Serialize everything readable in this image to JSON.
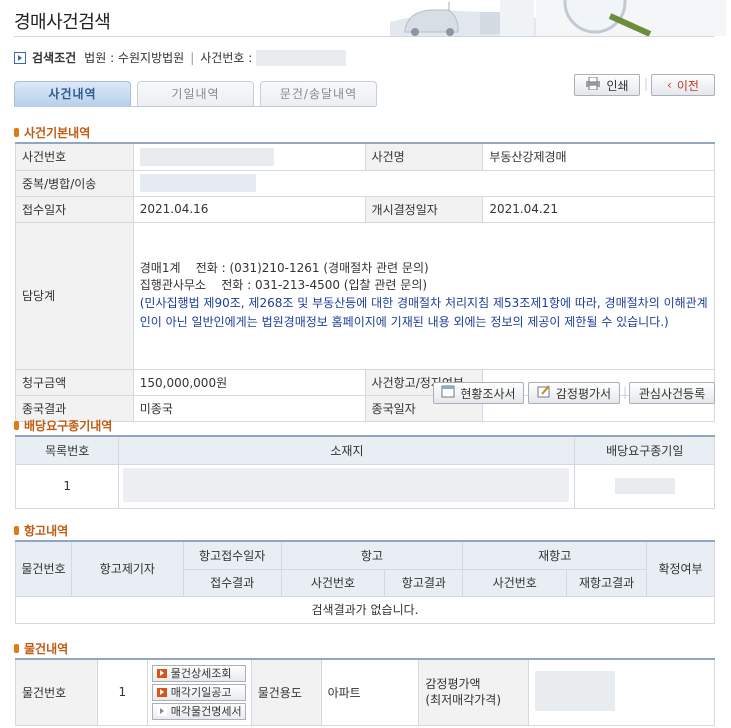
{
  "page": {
    "title": "경매사건검색"
  },
  "search_condition": {
    "label": "검색조건",
    "court_label": "법원 :",
    "court_value": "수원지방법원",
    "case_label": "사건번호 :"
  },
  "tabs": [
    {
      "label": "사건내역",
      "active": true
    },
    {
      "label": "기일내역",
      "active": false
    },
    {
      "label": "문건/송달내역",
      "active": false
    }
  ],
  "actions": {
    "print": "인쇄",
    "back": "이전"
  },
  "case_basic": {
    "title": "사건기본내역",
    "case_no_label": "사건번호",
    "case_name_label": "사건명",
    "case_name_value": "부동산강제경매",
    "merge_label": "중복/병합/이송",
    "received_label": "접수일자",
    "received_value": "2021.04.16",
    "start_label": "개시결정일자",
    "start_value": "2021.04.21",
    "officer_label": "담당계",
    "officer_line1": "경매1계    전화 : (031)210-1261 (경매절차 관련 문의)",
    "officer_line2": "집행관사무소    전화 : 031-213-4500 (입찰 관련 문의)",
    "officer_notice": "(민사집행법 제90조, 제268조 및 부동산등에 대한 경매절차 처리지침 제53조제1항에 따라, 경매절차의 이해관계인이 아닌 일반인에게는 법원경매정보 홈페이지에 기재된 내용 외에는 정보의 제공이 제한될 수 있습니다.)",
    "claim_label": "청구금액",
    "claim_value": "150,000,000원",
    "appeal_label": "사건항고/정지여부",
    "final_label": "종국결과",
    "final_value": "미종국",
    "final_date_label": "종국일자"
  },
  "case_buttons": {
    "survey": "현황조사서",
    "appraisal": "감정평가서",
    "watch": "관심사건등록"
  },
  "dividend": {
    "title": "배당요구종기내역",
    "headers": [
      "목록번호",
      "소재지",
      "배당요구종기일"
    ],
    "row_no": "1"
  },
  "appeal": {
    "title": "항고내역",
    "h_item": "물건번호",
    "h_appellant": "항고제기자",
    "h_date": "항고접수일자",
    "h_result": "접수결과",
    "h_appeal": "항고",
    "h_reappeal": "재항고",
    "h_confirm": "확정여부",
    "h_case": "사건번호",
    "h_appeal_result": "항고결과",
    "h_recase": "사건번호",
    "h_reappeal_result": "재항고결과",
    "empty": "검색결과가 없습니다."
  },
  "items": {
    "title": "물건내역",
    "item_no_label": "물건번호",
    "item_no_value": "1",
    "btn_detail": "물건상세조회",
    "btn_sale_date": "매각기일공고",
    "btn_sale_list": "매각물건명세서",
    "usage_label": "물건용도",
    "usage_value": "아파트",
    "appraisal_label": "감정평가액",
    "appraisal_sub": "(최저매각가격)"
  }
}
